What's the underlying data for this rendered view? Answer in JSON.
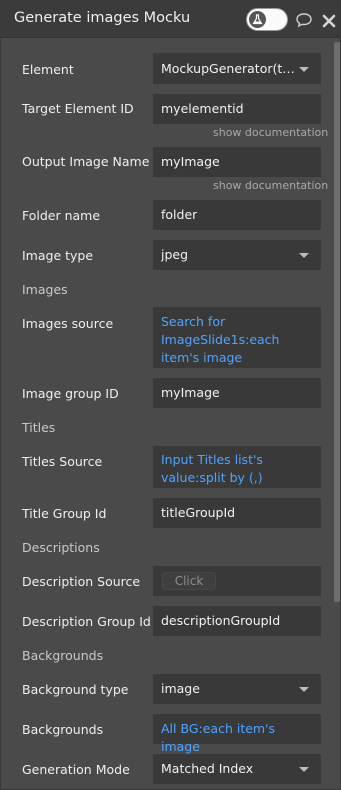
{
  "header": {
    "title": "Generate images Mocku"
  },
  "rows": {
    "element": {
      "label": "Element",
      "value": "MockupGenerator(testi..."
    },
    "target_element_id": {
      "label": "Target Element ID",
      "value": "myelementid",
      "doc": "show documentation"
    },
    "output_image_name": {
      "label": "Output Image Name",
      "value": "myImage",
      "doc": "show documentation"
    },
    "folder_name": {
      "label": "Folder name",
      "value": "folder"
    },
    "image_type": {
      "label": "Image type",
      "value": "jpeg"
    },
    "images_section": "Images",
    "images_source": {
      "label": "Images source",
      "value": "Search for ImageSlide1s:each item's image"
    },
    "image_group_id": {
      "label": "Image group ID",
      "value": "myImage"
    },
    "titles_section": "Titles",
    "titles_source": {
      "label": "Titles Source",
      "value": "Input Titles list's value:split by (,)"
    },
    "title_group_id": {
      "label": "Title Group Id",
      "value": "titleGroupId"
    },
    "descriptions_section": "Descriptions",
    "description_source": {
      "label": "Description Source",
      "button": "Click"
    },
    "description_group_id": {
      "label": "Description Group Id",
      "value": "descriptionGroupId"
    },
    "backgrounds_section": "Backgrounds",
    "background_type": {
      "label": "Background type",
      "value": "image"
    },
    "backgrounds": {
      "label": "Backgrounds",
      "value": "All BG:each item's image"
    },
    "generation_mode": {
      "label": "Generation Mode",
      "value": "Matched Index"
    }
  }
}
